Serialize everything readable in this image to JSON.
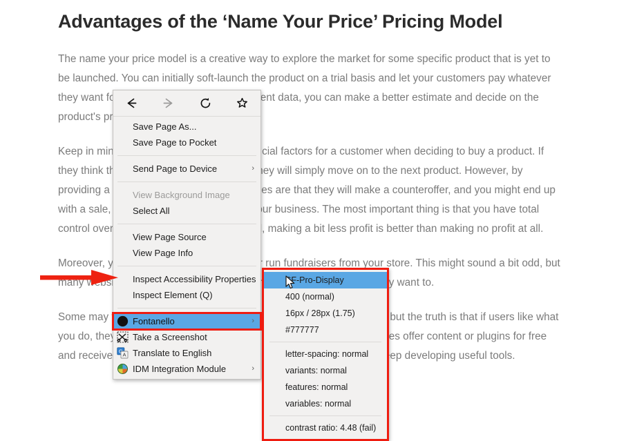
{
  "article": {
    "title": "Advantages of the ‘Name Your Price’ Pricing Model",
    "paragraphs": [
      "The name your price model is a creative way to explore the market for some specific product that is yet to be launched. You can initially soft-launch the product on a trial basis and let your customers pay whatever they want for it. Then, after gathering sufficient data, you can make a better estimate and decide on the product's price.",
      "Keep in mind that the price is one of the crucial factors for a customer when deciding to buy a product. If they think that your product is overpriced, they will simply move on to the next product. However, by providing a “name your price” option, chances are that they will make a counteroffer, and you might end up with a sale, which, in the end, is good for your business. The most important thing is that you have total control over how low you can go. In the end, making a bit less profit is better than making no profit at all.",
      "Moreover, you can also accept donations or run fundraisers from your store. This might sound a bit odd, but many websites have a “Donation” button where users can donate if they want to.",
      "Some may think “Why would someone pay for something that is free?” but the truth is that if users like what you do, they are probably willing to support you. For example, many sites offer content or plugins for free and receive donations from their users that in turn support them and keep developing useful tools."
    ]
  },
  "context_menu": {
    "nav": [
      {
        "name": "back",
        "label": "Back",
        "enabled": true
      },
      {
        "name": "forward",
        "label": "Forward",
        "enabled": false
      },
      {
        "name": "reload",
        "label": "Reload",
        "enabled": true
      },
      {
        "name": "bookmark",
        "label": "Bookmark This Page",
        "enabled": true
      }
    ],
    "groups": [
      {
        "items": [
          {
            "label": "Save Page As...",
            "disabled": false,
            "submenu": false,
            "icon": null
          },
          {
            "label": "Save Page to Pocket",
            "disabled": false,
            "submenu": false,
            "icon": null
          }
        ]
      },
      {
        "items": [
          {
            "label": "Send Page to Device",
            "disabled": false,
            "submenu": true,
            "icon": null
          }
        ]
      },
      {
        "items": [
          {
            "label": "View Background Image",
            "disabled": true,
            "submenu": false,
            "icon": null
          },
          {
            "label": "Select All",
            "disabled": false,
            "submenu": false,
            "icon": null
          }
        ]
      },
      {
        "items": [
          {
            "label": "View Page Source",
            "disabled": false,
            "submenu": false,
            "icon": null
          },
          {
            "label": "View Page Info",
            "disabled": false,
            "submenu": false,
            "icon": null
          }
        ]
      },
      {
        "items": [
          {
            "label": "Inspect Accessibility Properties",
            "disabled": false,
            "submenu": false,
            "icon": null
          },
          {
            "label": "Inspect Element (Q)",
            "disabled": false,
            "submenu": false,
            "icon": null
          }
        ]
      },
      {
        "items": [
          {
            "label": "Fontanello",
            "disabled": false,
            "submenu": true,
            "icon": "fontanello-icon",
            "highlighted": true
          },
          {
            "label": "Take a Screenshot",
            "disabled": false,
            "submenu": false,
            "icon": "scissors-icon"
          },
          {
            "label": "Translate to English",
            "disabled": false,
            "submenu": false,
            "icon": "translate-icon"
          },
          {
            "label": "IDM Integration Module",
            "disabled": false,
            "submenu": true,
            "icon": "idm-globe-icon"
          }
        ]
      }
    ]
  },
  "font_panel": {
    "rows_top": [
      {
        "label": "SF-Pro-Display",
        "highlighted": true
      },
      {
        "label": "400 (normal)",
        "highlighted": false
      },
      {
        "label": "16px / 28px (1.75)",
        "highlighted": false
      },
      {
        "label": "#777777",
        "highlighted": false
      }
    ],
    "rows_mid": [
      {
        "label": "letter-spacing: normal"
      },
      {
        "label": "variants: normal"
      },
      {
        "label": "features: normal"
      },
      {
        "label": "variables: normal"
      }
    ],
    "rows_bottom": [
      {
        "label": "contrast ratio: 4.48 (fail)"
      }
    ]
  },
  "annotation": {
    "arrow_color": "#ee2211",
    "highlight_border_color": "#ef1c10"
  },
  "colors": {
    "menu_bg": "#f2f1f0",
    "menu_border": "#c4c2c0",
    "highlight_blue": "#5aa7e4",
    "body_text": "#7b7b7b",
    "heading_text": "#2b2b2b"
  }
}
